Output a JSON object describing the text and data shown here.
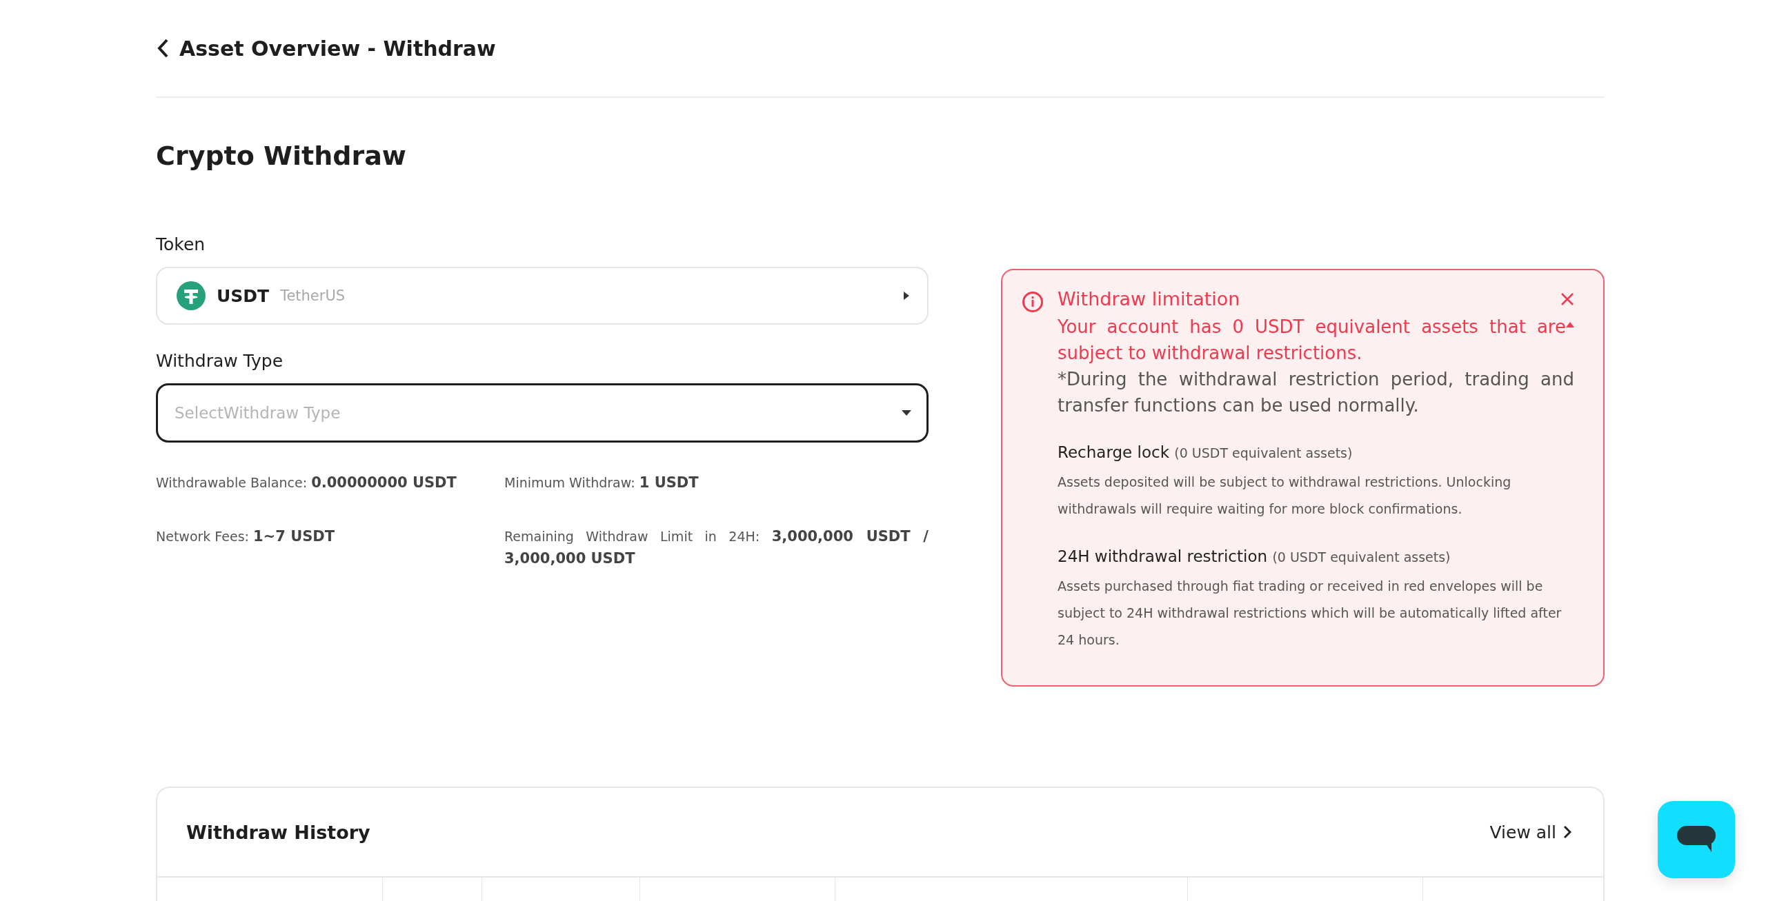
{
  "header": {
    "title": "Asset Overview - Withdraw"
  },
  "page_title": "Crypto Withdraw",
  "token": {
    "label": "Token",
    "symbol": "USDT",
    "name": "TetherUS"
  },
  "withdraw_type": {
    "label": "Withdraw Type",
    "placeholder": "SelectWithdraw Type"
  },
  "info": [
    {
      "label": "Withdrawable Balance:",
      "value": "0.00000000 USDT"
    },
    {
      "label": "Minimum Withdraw:",
      "value": "1 USDT"
    },
    {
      "label": "Network Fees:",
      "value": "1~7 USDT"
    },
    {
      "label": "Remaining Withdraw Limit in 24H:",
      "value": "3,000,000 USDT / 3,000,000 USDT"
    }
  ],
  "alert": {
    "title": "Withdraw limitation",
    "message": "Your account has 0 USDT equivalent assets that are subject to withdrawal restrictions.",
    "expanded": true,
    "note": "*During the withdrawal restriction period, trading and transfer functions can be used normally.",
    "sections": [
      {
        "title": "Recharge lock",
        "amount": "(0 USDT equivalent assets)",
        "text": "Assets deposited will be subject to withdrawal restrictions. Unlocking withdrawals will require waiting for more block confirmations."
      },
      {
        "title": "24H withdrawal restriction",
        "amount": "(0 USDT equivalent assets)",
        "text": "Assets purchased through fiat trading or received in red envelopes will be subject to 24H withdrawal restrictions which will be automatically lifted after 24 hours."
      }
    ]
  },
  "history": {
    "title": "Withdraw History",
    "link": "View all"
  }
}
